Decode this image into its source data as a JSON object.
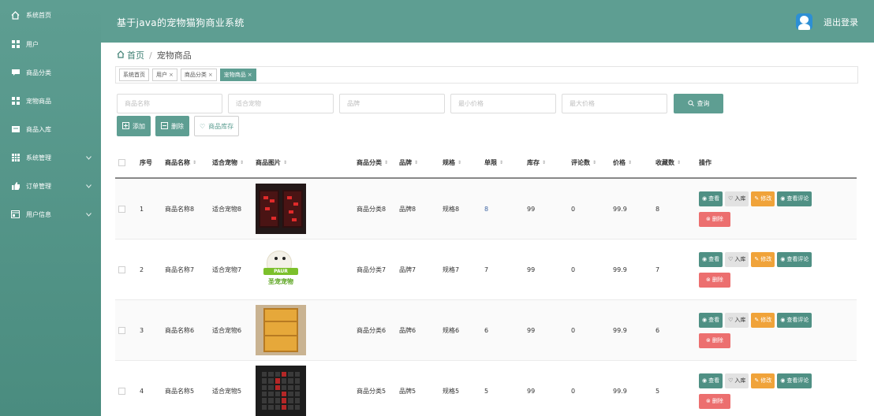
{
  "app": {
    "title": "基于java的宠物猫狗商业系统",
    "logout": "退出登录"
  },
  "sidebar": {
    "items": [
      {
        "label": "系统首页",
        "icon": "home-icon",
        "has_arrow": false
      },
      {
        "label": "用户",
        "icon": "grid-icon",
        "has_arrow": false
      },
      {
        "label": "商品分类",
        "icon": "message-icon",
        "has_arrow": false
      },
      {
        "label": "宠物商品",
        "icon": "grid-icon",
        "has_arrow": false
      },
      {
        "label": "商品入库",
        "icon": "inbox-icon",
        "has_arrow": false
      },
      {
        "label": "系统管理",
        "icon": "table-icon",
        "has_arrow": true
      },
      {
        "label": "订单管理",
        "icon": "thumb-icon",
        "has_arrow": true
      },
      {
        "label": "用户信息",
        "icon": "card-icon",
        "has_arrow": true
      }
    ]
  },
  "breadcrumb": {
    "home": "首页",
    "sep": "/",
    "current": "宠物商品"
  },
  "tags": [
    {
      "label": "系统首页",
      "closable": false,
      "active": false
    },
    {
      "label": "用户",
      "closable": true,
      "active": false
    },
    {
      "label": "商品分类",
      "closable": true,
      "active": false
    },
    {
      "label": "宠物商品",
      "closable": true,
      "active": true
    }
  ],
  "search": {
    "name_placeholder": "商品名称",
    "pet_placeholder": "适合宠物",
    "brand_placeholder": "品牌",
    "min_price_placeholder": "最小价格",
    "max_price_placeholder": "最大价格",
    "button": "查询"
  },
  "actions": {
    "add": "添加",
    "delete": "删除",
    "stock": "商品库存"
  },
  "table": {
    "headers": [
      "序号",
      "商品名称",
      "适合宠物",
      "商品图片",
      "商品分类",
      "品牌",
      "规格",
      "单限",
      "库存",
      "评论数",
      "价格",
      "收藏数",
      "操作"
    ],
    "ops": {
      "view": "查看",
      "stock_in": "入库",
      "edit": "修改",
      "review": "查看评论",
      "delete": "删除"
    },
    "rows": [
      {
        "no": "1",
        "name": "商品名称8",
        "pet": "适合宠物8",
        "category": "商品分类8",
        "brand": "品牌8",
        "spec": "规格8",
        "limit": "8",
        "stock": "99",
        "comments": "0",
        "price": "99.9",
        "fav": "8",
        "pic": "pic1"
      },
      {
        "no": "2",
        "name": "商品名称7",
        "pet": "适合宠物7",
        "category": "商品分类7",
        "brand": "品牌7",
        "spec": "规格7",
        "limit": "7",
        "stock": "99",
        "comments": "0",
        "price": "99.9",
        "fav": "7",
        "pic": "pic2"
      },
      {
        "no": "3",
        "name": "商品名称6",
        "pet": "适合宠物6",
        "category": "商品分类6",
        "brand": "品牌6",
        "spec": "规格6",
        "limit": "6",
        "stock": "99",
        "comments": "0",
        "price": "99.9",
        "fav": "6",
        "pic": "pic3"
      },
      {
        "no": "4",
        "name": "商品名称5",
        "pet": "适合宠物5",
        "category": "商品分类5",
        "brand": "品牌5",
        "spec": "规格5",
        "limit": "5",
        "stock": "99",
        "comments": "0",
        "price": "99.9",
        "fav": "5",
        "pic": "pic4"
      }
    ]
  },
  "pic2_text": {
    "logo": "PAUR",
    "caption": "圣宠宠物"
  },
  "colors": {
    "primary": "#5e9e92",
    "edit": "#f0a33a",
    "delete": "#ec6f6f"
  }
}
